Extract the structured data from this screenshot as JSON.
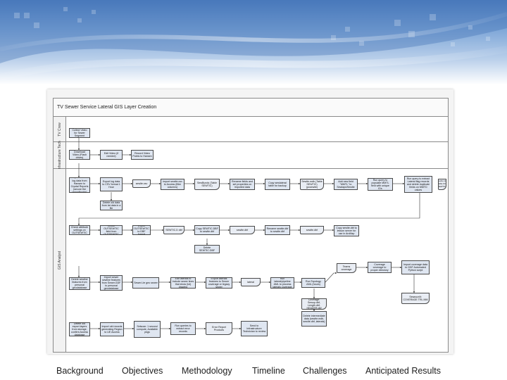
{
  "diagram": {
    "title": "TV Sewer Service Lateral GIS Layer Creation",
    "lanes": [
      {
        "id": "tv",
        "label": "TV Crew"
      },
      {
        "id": "infra",
        "label": "Infrastructure Tech"
      },
      {
        "id": "gis",
        "label": "GIS Analyst"
      }
    ],
    "nodes": {
      "n1": "Collect Video for Sewer Segment",
      "n2": "Download Video (Flash drives)",
      "n3": "Edit Video (if needed)",
      "n4": "Record Video Points to Hansen",
      "n5": "Import CCTV log data from Hansen to Crystal Reports (secure the recordbooks)",
      "n6": "Export log data to CSV format 1 Hour",
      "n7": "sewlte.csv",
      "n8": "Import sewlte.csv to Access (filter columns)",
      "n9": "SewBunds (Table SEWTIC)",
      "n10": "Rename fields and set properties on imported data",
      "n11": "Copy sewlateral table for backup",
      "n12": "Sewlte.mdb (Table SEWTIC) (pcsewlte)",
      "n13": "Add new field \"MMTL\" to Sewlaps/Sewlte",
      "n14": "Run query to populate MMTL field with unique IDs",
      "n15": "Run query to extract Lateral flag records and delete duplicate fields on MMTD values",
      "n16": "Sewlte.mdb (Table OUT SEWTIC)",
      "n17": "Delete old data from lat data in a file",
      "n18": "Check attribute settings on OUTSEWTIC",
      "n19": "Sewlte OUTSEWTIC field from OUTSEWTIC",
      "n20": "Export OUTSEWTIC to DBF format",
      "n21": "SEWTIC.D dbf",
      "n22": "Copy SEWTIC.DBF to sewlte.dbf",
      "n23": "sewlte.dbf",
      "n24": "Rename sewlte.dbf to sewlte.dbf",
      "n25": "sewlte.dbf",
      "n26": "Copy sewlte.dbf to lesson server for use in ArcMap",
      "n27": "Delete SEWTIC.DBF",
      "n28": "Teams coverage",
      "n29": "Coverage coverage to proper directory",
      "n30": "Import coverage data to GDF Automated Python script",
      "n31": "Delete sewline features from personal geodatabase",
      "n32": "Import sewer sewline features from Sewer.GDF to personal geodatabase",
      "n33": "Sewer.Lte geo sewer",
      "n34": "Edit laterals to include sewer lines that show (lot) drawing",
      "n35": "Export laterals features to Sewer coverage or legacy sewer",
      "n36": "lateral",
      "n37": "Run lateral/pipeline AML to process laterals coverage",
      "n38": "Run Topology AML (hours)",
      "n39": "Coverage: Sewup.dbf, Length.dbf, HEADER.dbf",
      "n40": "Sewuscriit: COVERAGE TRL.MM",
      "n41": "Delete intermediate data (sewlte.mdb, sewlte.dbf, laterals)",
      "n42": "Delete old export layers from storage, confirm Access database",
      "n43": "Import old records generating Region to UE Access",
      "n44": "Selscan: 1 second compute, Available pkgs",
      "n45": "Run queries to extract error records",
      "n46": "Error Report Products",
      "n47": "Send to Infrastructure Technician to review"
    }
  },
  "nav": {
    "items": [
      "Background",
      "Objectives",
      "Methodology",
      "Timeline",
      "Challenges",
      "Anticipated Results"
    ]
  }
}
